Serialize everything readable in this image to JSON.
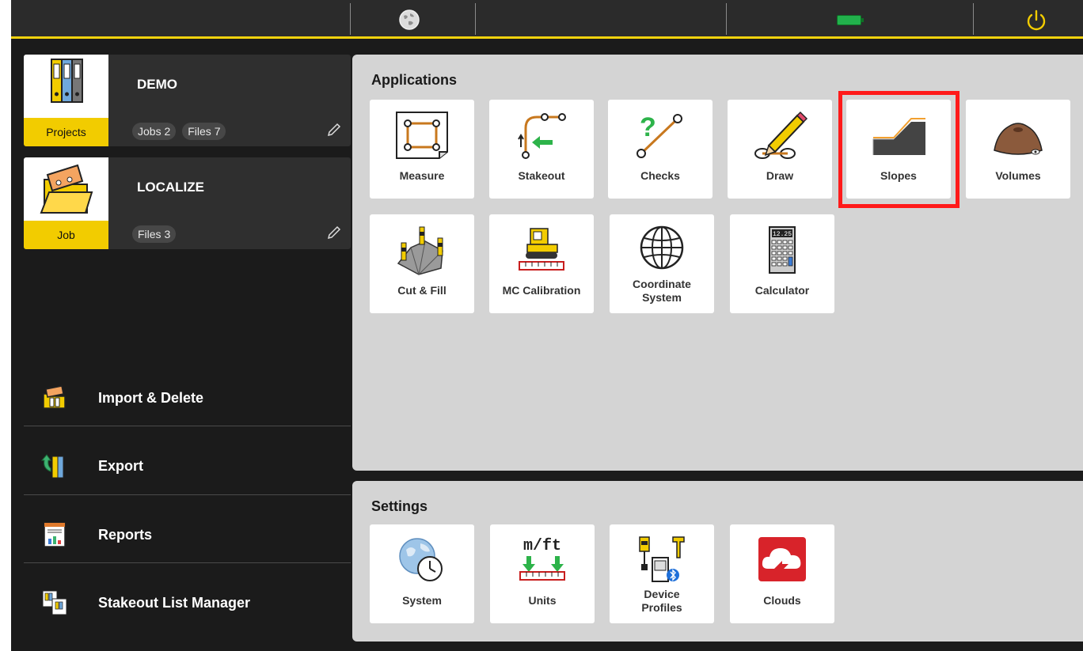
{
  "colors": {
    "accent": "#f2cc00",
    "highlight": "#ff1a1a",
    "background": "#1b1b1b",
    "panel": "#d4d4d4"
  },
  "topbar": {
    "globe_icon": "globe-icon",
    "battery_icon": "battery-icon",
    "power_icon": "power-icon"
  },
  "project_card": {
    "name": "DEMO",
    "tag": "Projects",
    "jobs": "Jobs 2",
    "files": "Files 7"
  },
  "job_card": {
    "name": "LOCALIZE",
    "tag": "Job",
    "files": "Files 3"
  },
  "menu": {
    "import_delete": "Import & Delete",
    "export": "Export",
    "reports": "Reports",
    "stakeout_list_manager": "Stakeout List Manager"
  },
  "applications": {
    "title": "Applications",
    "measure": "Measure",
    "stakeout": "Stakeout",
    "checks": "Checks",
    "draw": "Draw",
    "slopes": "Slopes",
    "volumes": "Volumes",
    "cut_fill": "Cut & Fill",
    "mc_calibration": "MC Calibration",
    "coordinate_system_1": "Coordinate",
    "coordinate_system_2": "System",
    "calculator": "Calculator",
    "calculator_display": "12.25"
  },
  "settings": {
    "title": "Settings",
    "system": "System",
    "units": "Units",
    "units_icon_text": "m/ft",
    "device_profiles_1": "Device",
    "device_profiles_2": "Profiles",
    "clouds": "Clouds"
  }
}
